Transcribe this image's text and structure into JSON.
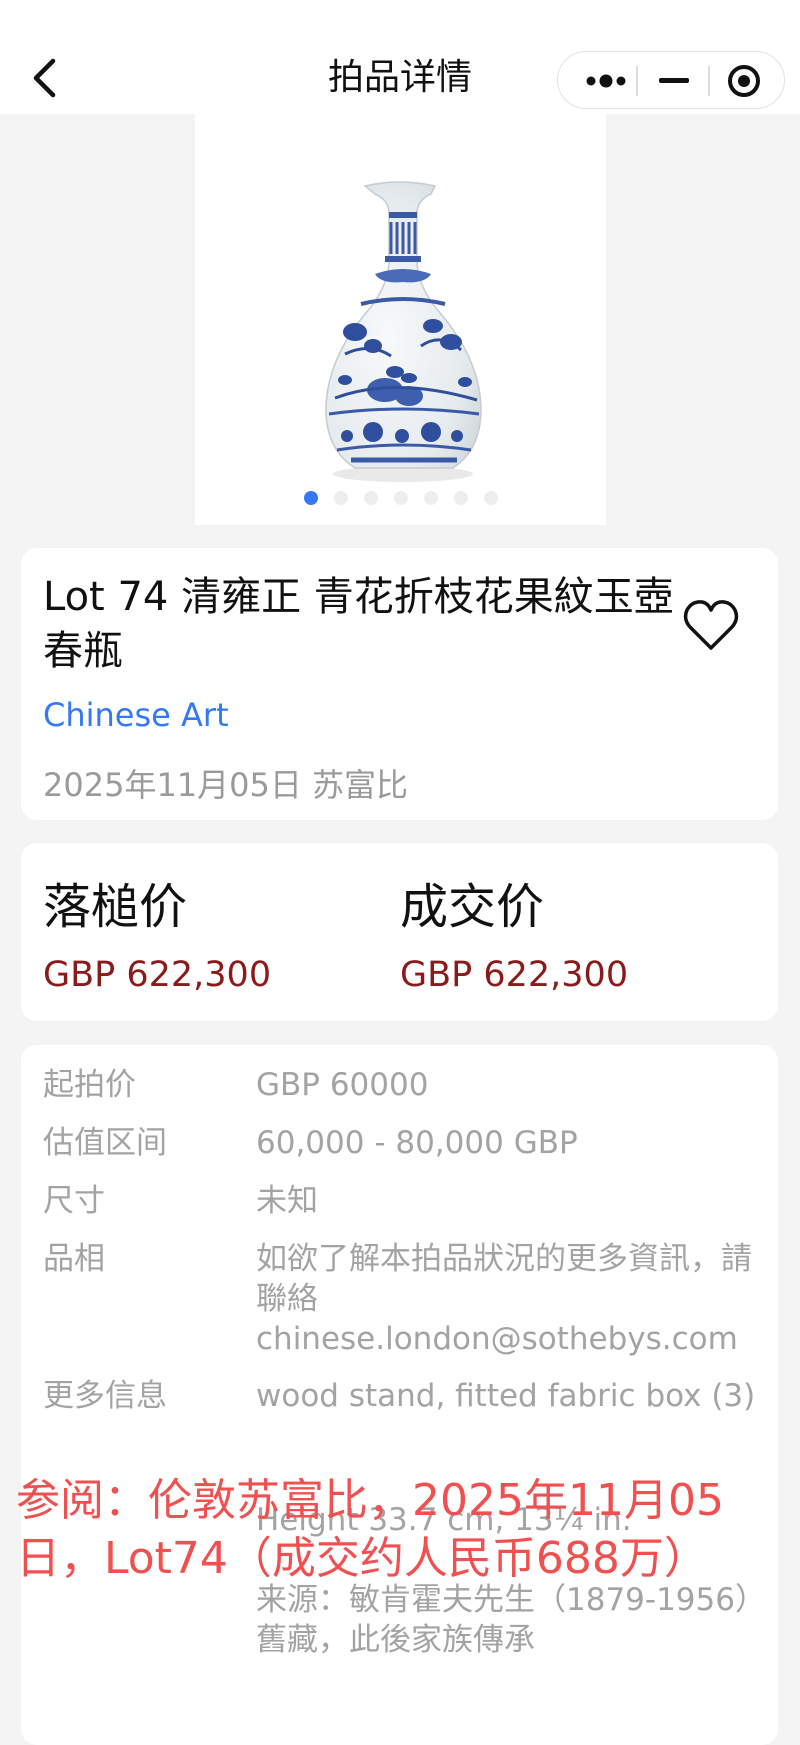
{
  "nav": {
    "title": "拍品详情",
    "icons": [
      "back-arrow-icon",
      "more-dots-icon",
      "minimize-icon",
      "close-target-icon"
    ]
  },
  "gallery": {
    "image": "blue-and-white-yuhuchunping-vase",
    "slide_count": 7,
    "active_index": 0
  },
  "lot": {
    "title": "Lot 74 清雍正 青花折枝花果紋玉壺春瓶",
    "category": "Chinese Art",
    "date_house": "2025年11月05日 苏富比",
    "favorite_icon": "heart-outline-icon"
  },
  "prices": {
    "hammer_label": "落槌价",
    "hammer_value": "GBP 622,300",
    "deal_label": "成交价",
    "deal_value": "GBP 622,300"
  },
  "details": [
    {
      "key": "起拍价",
      "value": "GBP 60000"
    },
    {
      "key": "估值区间",
      "value": "60,000 - 80,000 GBP"
    },
    {
      "key": "尺寸",
      "value": "未知"
    },
    {
      "key": "品相",
      "value": "如欲了解本拍品狀況的更多資訊，請聯絡 chinese.london@sothebys.com"
    },
    {
      "key": "更多信息",
      "value": "wood stand, fitted fabric box (3)"
    },
    {
      "key": "",
      "value": "Height 33.7 cm, 13¼ in."
    },
    {
      "key": "",
      "value": "来源：敏肯霍夫先生（1879-1956）舊藏，此後家族傳承"
    }
  ],
  "watermark": "参阅：伦敦苏富比，2025年11月05日，Lot74（成交约人民币688万）",
  "colors": {
    "accent": "#3478f6",
    "price": "#8b1a1a",
    "watermark": "#f05050",
    "muted": "#9a9a9a"
  }
}
